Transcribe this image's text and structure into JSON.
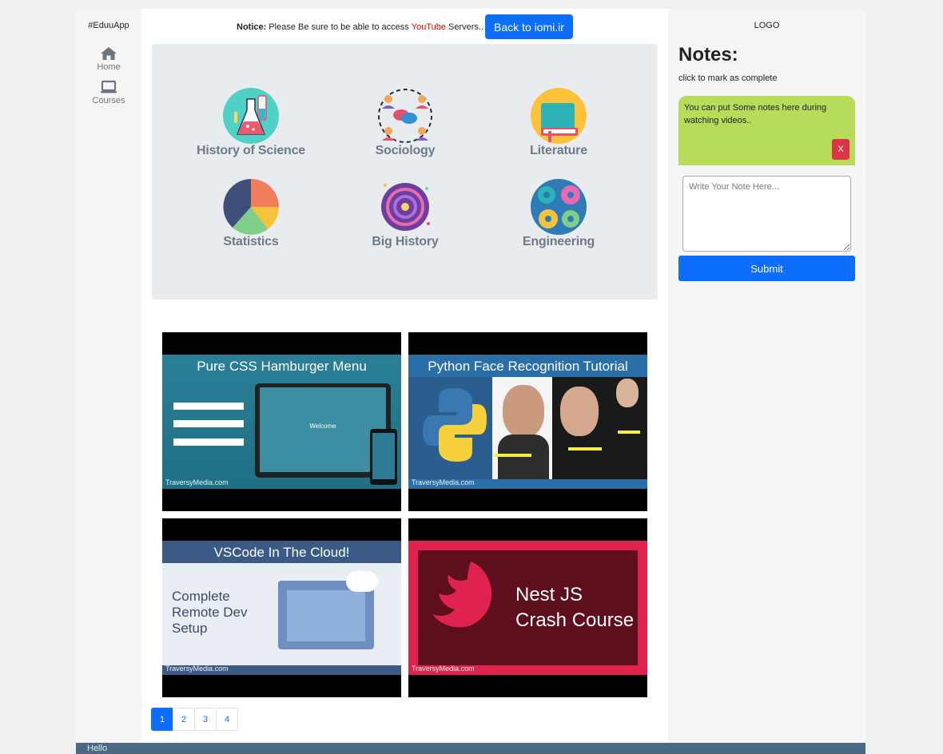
{
  "app": {
    "brand": "#EduuApp",
    "logo": "LOGO"
  },
  "nav": {
    "home": {
      "label": "Home",
      "icon": "home-icon"
    },
    "courses": {
      "label": "Courses",
      "icon": "laptop-icon"
    }
  },
  "notice": {
    "prefix": "Notice:",
    "text_before": "Please Be sure to be able to access",
    "highlight": "YouTube",
    "text_after": "Servers..",
    "back_button": "Back to iomi.ir"
  },
  "categories": [
    {
      "label": "History of Science",
      "icon": "flask-icon"
    },
    {
      "label": "Sociology",
      "icon": "people-chat-icon"
    },
    {
      "label": "Literature",
      "icon": "book-icon"
    },
    {
      "label": "Statistics",
      "icon": "pie-chart-icon"
    },
    {
      "label": "Big History",
      "icon": "galaxy-icon"
    },
    {
      "label": "Engineering",
      "icon": "gears-icon"
    }
  ],
  "videos": [
    {
      "title": "Pure CSS Hamburger Menu",
      "channel": "TraversyMedia.com",
      "screen_text": "Welcome"
    },
    {
      "title": "Python Face Recognition Tutorial",
      "channel": "TraversyMedia.com"
    },
    {
      "title": "VSCode In The Cloud!",
      "subtitle_line1": "Complete",
      "subtitle_line2": "Remote Dev",
      "subtitle_line3": "Setup",
      "channel": "TraversyMedia.com"
    },
    {
      "title_line1": "Nest JS",
      "title_line2": "Crash Course",
      "channel": "TraversyMedia.com"
    }
  ],
  "pagination": [
    "1",
    "2",
    "3",
    "4"
  ],
  "notes": {
    "title": "Notes:",
    "subtitle": "click to mark as complete",
    "items": [
      {
        "text": "You can put Some notes here during watching videos..",
        "delete_label": "X"
      }
    ],
    "input_placeholder": "Write Your Note Here...",
    "submit_label": "Submit"
  },
  "footer": {
    "text": "Hello"
  },
  "colors": {
    "primary": "#0d6efd",
    "danger": "#dc3545",
    "note": "#b7dc5a",
    "footer": "#4b6884",
    "youtube": "#e00000"
  }
}
